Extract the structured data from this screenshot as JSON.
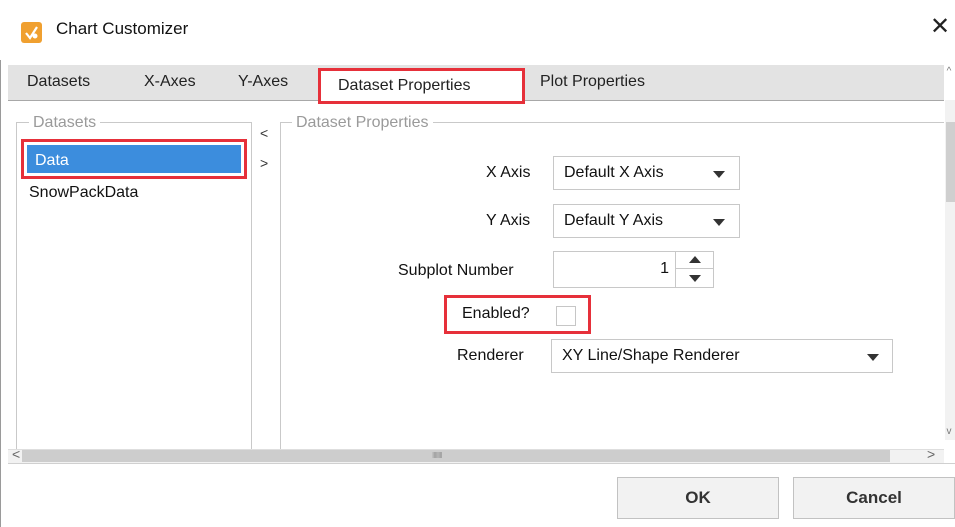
{
  "window": {
    "title": "Chart Customizer",
    "close_glyph": "✕",
    "icon": "chart-customizer-app-icon"
  },
  "tabs": [
    {
      "label": "Datasets"
    },
    {
      "label": "X-Axes"
    },
    {
      "label": "Y-Axes"
    },
    {
      "label": "Dataset Properties",
      "selected": true
    },
    {
      "label": "Plot Properties"
    }
  ],
  "datasets_panel": {
    "legend": "Datasets",
    "items": [
      {
        "label": "Data",
        "selected": true
      },
      {
        "label": "SnowPackData"
      }
    ],
    "collapse_left": "<",
    "collapse_right": ">"
  },
  "properties": {
    "legend": "Dataset Properties",
    "x_axis": {
      "label": "X Axis",
      "value": "Default X Axis"
    },
    "y_axis": {
      "label": "Y Axis",
      "value": "Default Y Axis"
    },
    "subplot": {
      "label": "Subplot Number",
      "value": "1"
    },
    "enabled": {
      "label": "Enabled?",
      "checked": false
    },
    "renderer": {
      "label": "Renderer",
      "value": "XY Line/Shape Renderer"
    }
  },
  "scrollbar": {
    "left": "<",
    "right": ">",
    "grip": "IIIIIIII",
    "up": "^",
    "down": "v"
  },
  "buttons": {
    "ok": "OK",
    "cancel": "Cancel"
  },
  "colors": {
    "highlight": "#e6303a",
    "selection": "#3c8ddd",
    "tabbar": "#e3e3e3"
  }
}
